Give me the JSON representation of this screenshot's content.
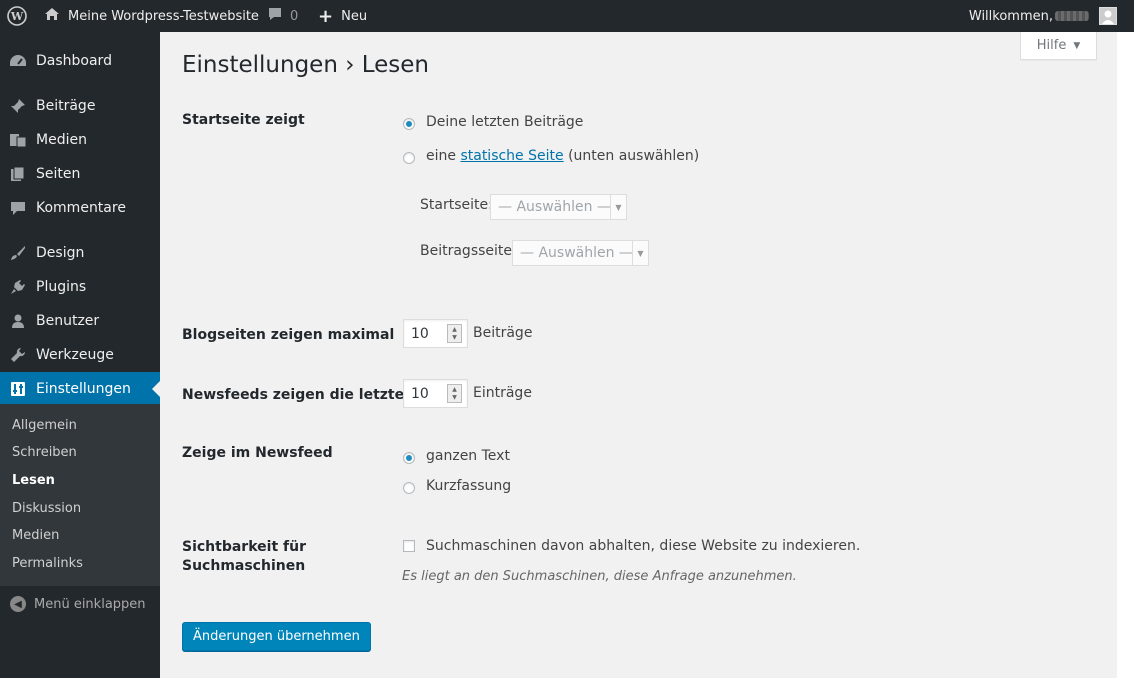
{
  "adminbar": {
    "site_name": "Meine Wordpress-Testwebsite",
    "comment_count": "0",
    "new_label": "Neu",
    "welcome": "Willkommen,"
  },
  "sidebar": {
    "items": [
      {
        "label": "Dashboard",
        "icon": "dashboard-icon"
      },
      {
        "label": "Beiträge",
        "icon": "pin-icon"
      },
      {
        "label": "Medien",
        "icon": "media-icon"
      },
      {
        "label": "Seiten",
        "icon": "pages-icon"
      },
      {
        "label": "Kommentare",
        "icon": "comment-icon"
      },
      {
        "label": "Design",
        "icon": "brush-icon"
      },
      {
        "label": "Plugins",
        "icon": "plugin-icon"
      },
      {
        "label": "Benutzer",
        "icon": "user-icon"
      },
      {
        "label": "Werkzeuge",
        "icon": "wrench-icon"
      },
      {
        "label": "Einstellungen",
        "icon": "settings-icon"
      }
    ],
    "submenu": [
      "Allgemein",
      "Schreiben",
      "Lesen",
      "Diskussion",
      "Medien",
      "Permalinks"
    ],
    "collapse_label": "Menü einklappen"
  },
  "help_label": "Hilfe",
  "page_title": "Einstellungen › Lesen",
  "front_page": {
    "label": "Startseite zeigt",
    "option_latest": "Deine letzten Beiträge",
    "option_static_prefix": "eine",
    "option_static_link": "statische Seite",
    "option_static_suffix": "(unten auswählen)",
    "front_select_label": "Startseite:",
    "posts_select_label": "Beitragsseite:",
    "select_placeholder": "— Auswählen —"
  },
  "posts_per_page": {
    "label": "Blogseiten zeigen maximal",
    "value": "10",
    "unit": "Beiträge"
  },
  "posts_per_rss": {
    "label": "Newsfeeds zeigen die letzten",
    "value": "10",
    "unit": "Einträge"
  },
  "rss_use_excerpt": {
    "label": "Zeige im Newsfeed",
    "option_full": "ganzen Text",
    "option_summary": "Kurzfassung"
  },
  "visibility": {
    "label_line1": "Sichtbarkeit für",
    "label_line2": "Suchmaschinen",
    "checkbox_label": "Suchmaschinen davon abhalten, diese Website zu indexieren.",
    "hint": "Es liegt an den Suchmaschinen, diese Anfrage anzunehmen."
  },
  "submit_label": "Änderungen übernehmen"
}
